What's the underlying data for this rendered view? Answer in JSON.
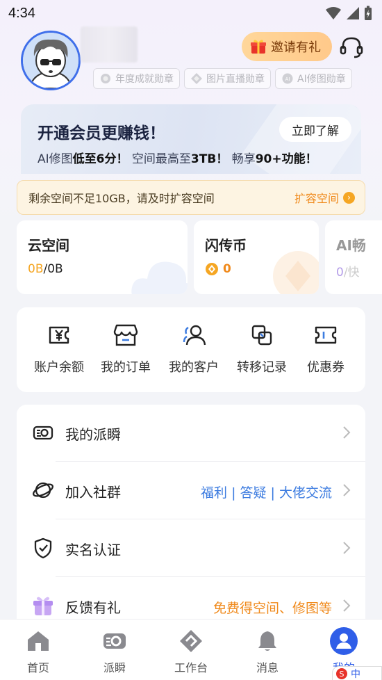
{
  "status": {
    "time": "4:34"
  },
  "profile": {
    "invite_label": "邀请有礼",
    "badges": [
      "年度成就勋章",
      "图片直播勋章",
      "AI修图勋章"
    ]
  },
  "vip": {
    "title": "开通会员更赚钱！",
    "button": "立即了解",
    "sub_parts": [
      "AI修图",
      "低至6分！",
      "空间最高至",
      "3TB！",
      "畅享",
      "90+功能！"
    ]
  },
  "warning": {
    "text": "剩余空间不足10GB，请及时扩容空间",
    "link": "扩容空间"
  },
  "stats": [
    {
      "title": "云空间",
      "used": "0B",
      "total": "/0B"
    },
    {
      "title": "闪传币",
      "value": "0"
    },
    {
      "title": "AI畅",
      "value_prefix": "0",
      "value_suffix": "/快"
    }
  ],
  "quick": [
    {
      "label": "账户余额",
      "icon": "yen-wallet-icon"
    },
    {
      "label": "我的订单",
      "icon": "store-icon"
    },
    {
      "label": "我的客户",
      "icon": "customers-icon"
    },
    {
      "label": "转移记录",
      "icon": "transfer-icon"
    },
    {
      "label": "优惠券",
      "icon": "coupon-icon"
    }
  ],
  "menu": [
    {
      "label": "我的派瞬",
      "extra": "",
      "icon": "paishun-icon"
    },
    {
      "label": "加入社群",
      "extra": "福利 | 答疑 | 大佬交流",
      "icon": "planet-icon"
    },
    {
      "label": "实名认证",
      "extra": "",
      "icon": "shield-check-icon"
    },
    {
      "label": "反馈有礼",
      "extra": "免费得空间、修图等",
      "icon": "gift-icon"
    }
  ],
  "tabs": [
    {
      "label": "首页",
      "icon": "home-icon"
    },
    {
      "label": "派瞬",
      "icon": "paishun-icon"
    },
    {
      "label": "工作台",
      "icon": "workbench-icon"
    },
    {
      "label": "消息",
      "icon": "bell-icon"
    },
    {
      "label": "我的",
      "icon": "user-icon"
    }
  ],
  "ime": {
    "label": "中"
  },
  "colors": {
    "accent": "#2f5ee8",
    "warning": "#f08a1c",
    "link_blue": "#3d7ce0"
  }
}
